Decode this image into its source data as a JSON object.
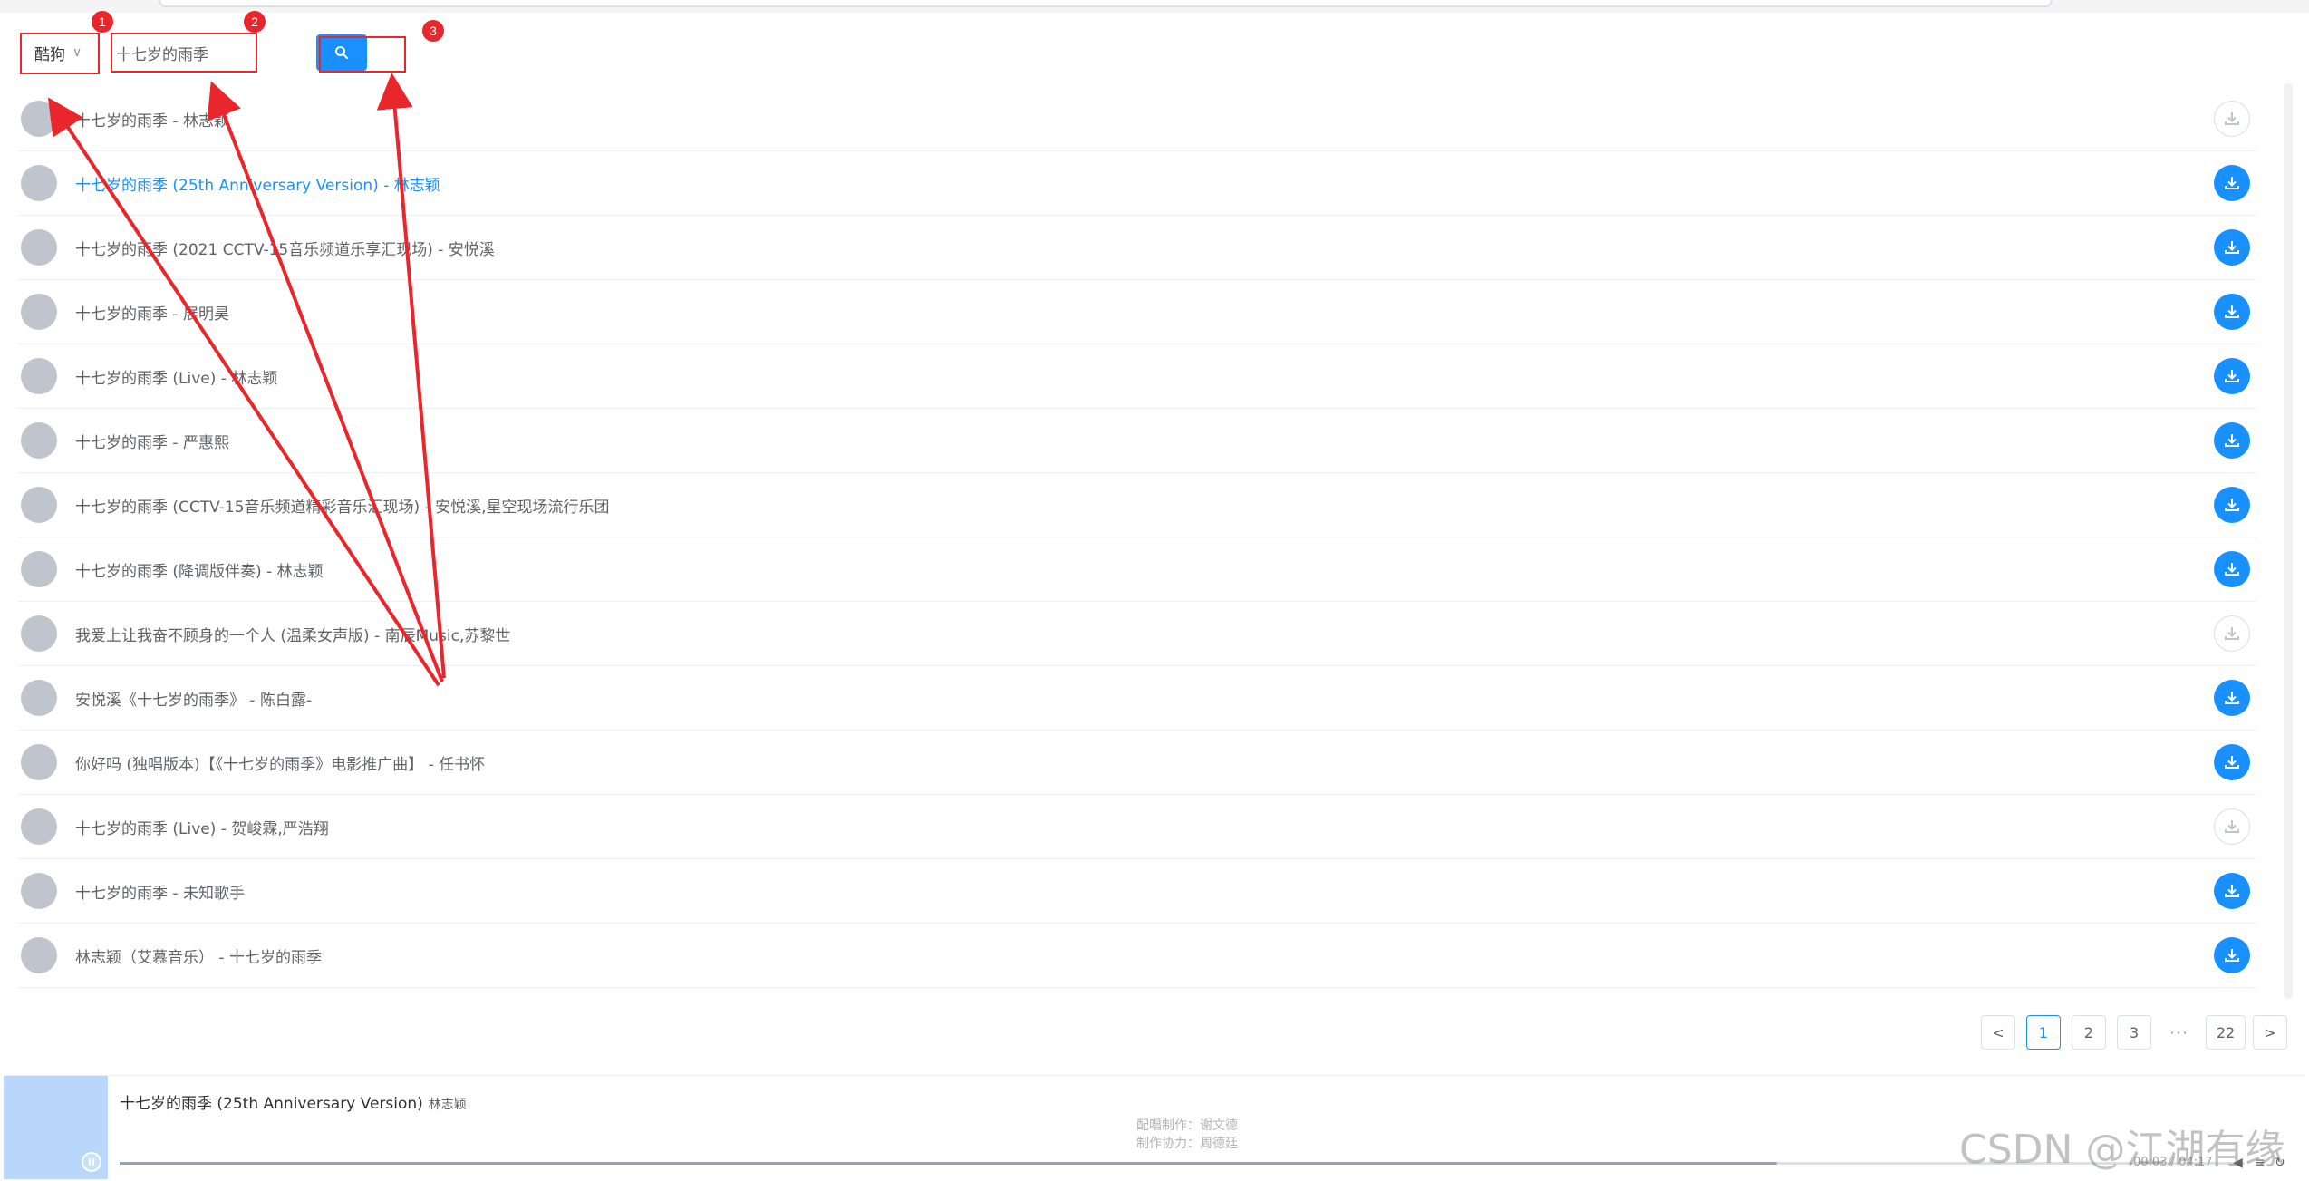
{
  "search": {
    "platform": "酷狗",
    "query": "十七岁的雨季"
  },
  "annotations": [
    "1",
    "2",
    "3"
  ],
  "results": [
    {
      "title": "十七岁的雨季 - 林志颖",
      "downloadable": false
    },
    {
      "title": "十七岁的雨季 (25th Anniversary Version) - 林志颖",
      "downloadable": true,
      "active": true
    },
    {
      "title": "十七岁的雨季 (2021 CCTV-15音乐频道乐享汇现场) - 安悦溪",
      "downloadable": true
    },
    {
      "title": "十七岁的雨季 - 展明昊",
      "downloadable": true
    },
    {
      "title": "十七岁的雨季 (Live) - 林志颖",
      "downloadable": true
    },
    {
      "title": "十七岁的雨季 - 严惠熙",
      "downloadable": true
    },
    {
      "title": "十七岁的雨季 (CCTV-15音乐频道精彩音乐汇现场) - 安悦溪,星空现场流行乐团",
      "downloadable": true
    },
    {
      "title": "十七岁的雨季 (降调版伴奏) - 林志颖",
      "downloadable": true
    },
    {
      "title": "我爱上让我奋不顾身的一个人 (温柔女声版) - 南辰Music,苏黎世",
      "downloadable": false
    },
    {
      "title": "安悦溪《十七岁的雨季》 - 陈白露-",
      "downloadable": true
    },
    {
      "title": "你好吗 (独唱版本)【《十七岁的雨季》电影推广曲】 - 任书怀",
      "downloadable": true
    },
    {
      "title": "十七岁的雨季 (Live) - 贺峻霖,严浩翔",
      "downloadable": false
    },
    {
      "title": "十七岁的雨季 - 未知歌手",
      "downloadable": true
    },
    {
      "title": "林志颖（艾慕音乐） - 十七岁的雨季",
      "downloadable": true
    }
  ],
  "pagination": {
    "prev": "<",
    "pages": [
      "1",
      "2",
      "3"
    ],
    "ellipsis": "···",
    "last": "22",
    "next": ">",
    "current": "1"
  },
  "player": {
    "title": "十七岁的雨季 (25th Anniversary Version)",
    "artist": "林志颖",
    "lyric_line1": "配唱制作：谢文德",
    "lyric_line2": "制作协力：周德廷",
    "time": "00:03 / 04:17",
    "progress": 0.002
  },
  "watermark": "CSDN @江湖有缘",
  "colors": {
    "accent": "#1890ff",
    "annotation": "#e8262c"
  }
}
